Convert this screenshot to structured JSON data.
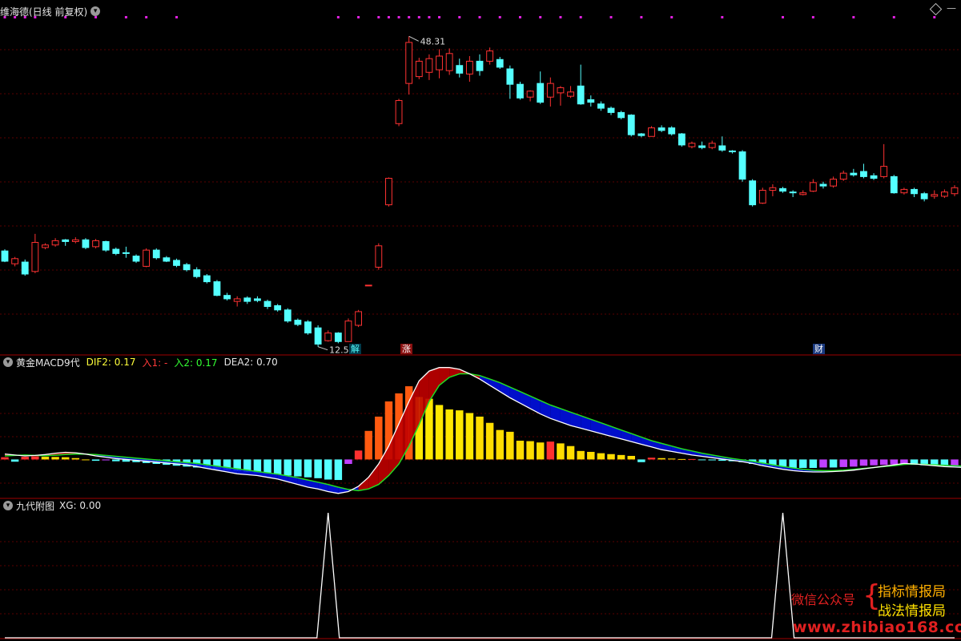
{
  "window": {
    "title": "维海德(日线 前复权)",
    "colors": {
      "bg": "#000000",
      "up": "#ff3232",
      "down": "#54ffff",
      "grid": "#5a0000",
      "panel_border": "#a00000"
    }
  },
  "main_panel": {
    "high_label": "48.31",
    "low_label": "12.59",
    "tags": [
      {
        "text": "解",
        "color": "#54ffff",
        "bg": "#003a4a"
      },
      {
        "text": "涨",
        "color": "#ffffff",
        "bg": "#8a1010"
      },
      {
        "text": "财",
        "color": "#ffffff",
        "bg": "#1a3a80"
      }
    ]
  },
  "macd_panel": {
    "title": "黄金MACD9代",
    "dif_label": "DIF2: 0.17",
    "in1_label": "入1: -",
    "in2_label": "入2: 0.17",
    "dea_label": "DEA2: 0.70"
  },
  "sub_panel": {
    "title": "九代附图",
    "xg_label": "XG: 0.00"
  },
  "watermark": {
    "line1": "微信公众号",
    "brand1": "指标情报局",
    "brand2": "战法情报局",
    "url": "www.zhibiao168.com"
  },
  "chart_data": [
    {
      "type": "candlestick",
      "title": "维海德(日线 前复权)",
      "ylim": [
        11.5,
        50.5
      ],
      "candles": [
        {
          "o": 23.2,
          "c": 22.0,
          "h": 23.4,
          "l": 21.9
        },
        {
          "o": 21.7,
          "c": 22.3,
          "h": 22.5,
          "l": 21.4
        },
        {
          "o": 21.9,
          "c": 20.5,
          "h": 22.2,
          "l": 20.3
        },
        {
          "o": 20.8,
          "c": 24.2,
          "h": 25.2,
          "l": 20.6
        },
        {
          "o": 23.6,
          "c": 23.9,
          "h": 24.1,
          "l": 23.4
        },
        {
          "o": 23.9,
          "c": 24.4,
          "h": 24.7,
          "l": 23.7
        },
        {
          "o": 24.5,
          "c": 24.3,
          "h": 24.6,
          "l": 23.8
        },
        {
          "o": 24.3,
          "c": 24.5,
          "h": 24.8,
          "l": 24.1
        },
        {
          "o": 24.5,
          "c": 23.6,
          "h": 24.7,
          "l": 23.4
        },
        {
          "o": 23.7,
          "c": 24.4,
          "h": 24.6,
          "l": 23.5
        },
        {
          "o": 24.3,
          "c": 23.3,
          "h": 24.4,
          "l": 23.1
        },
        {
          "o": 23.4,
          "c": 22.9,
          "h": 23.6,
          "l": 22.7
        },
        {
          "o": 23.0,
          "c": 22.9,
          "h": 23.7,
          "l": 22.4
        },
        {
          "o": 22.6,
          "c": 22.0,
          "h": 22.8,
          "l": 21.8
        },
        {
          "o": 21.4,
          "c": 23.3,
          "h": 23.5,
          "l": 21.3
        },
        {
          "o": 23.3,
          "c": 22.4,
          "h": 23.5,
          "l": 22.2
        },
        {
          "o": 22.4,
          "c": 22.0,
          "h": 22.6,
          "l": 21.9
        },
        {
          "o": 22.1,
          "c": 21.5,
          "h": 22.3,
          "l": 21.3
        },
        {
          "o": 21.6,
          "c": 21.0,
          "h": 21.8,
          "l": 20.8
        },
        {
          "o": 21.0,
          "c": 20.2,
          "h": 21.3,
          "l": 20.0
        },
        {
          "o": 20.3,
          "c": 19.6,
          "h": 20.5,
          "l": 19.4
        },
        {
          "o": 19.6,
          "c": 18.0,
          "h": 19.8,
          "l": 17.9
        },
        {
          "o": 18.0,
          "c": 17.6,
          "h": 18.3,
          "l": 17.4
        },
        {
          "o": 17.3,
          "c": 17.6,
          "h": 17.9,
          "l": 16.7
        },
        {
          "o": 17.7,
          "c": 17.3,
          "h": 17.9,
          "l": 17.0
        },
        {
          "o": 17.6,
          "c": 17.4,
          "h": 17.9,
          "l": 17.2
        },
        {
          "o": 17.3,
          "c": 16.7,
          "h": 17.5,
          "l": 16.4
        },
        {
          "o": 16.8,
          "c": 16.3,
          "h": 17.0,
          "l": 16.1
        },
        {
          "o": 16.3,
          "c": 15.0,
          "h": 16.5,
          "l": 14.8
        },
        {
          "o": 15.1,
          "c": 14.6,
          "h": 15.3,
          "l": 14.4
        },
        {
          "o": 14.9,
          "c": 13.6,
          "h": 15.1,
          "l": 13.4
        },
        {
          "o": 14.2,
          "c": 12.3,
          "h": 14.5,
          "l": 12.0
        },
        {
          "o": 12.7,
          "c": 13.6,
          "h": 13.9,
          "l": 12.59
        },
        {
          "o": 13.6,
          "c": 12.6,
          "h": 13.7,
          "l": 12.4
        },
        {
          "o": 12.6,
          "c": 15.0,
          "h": 15.3,
          "l": 12.6
        },
        {
          "o": 14.5,
          "c": 16.1,
          "h": 16.3,
          "l": 14.3
        },
        {
          "o": 19.2,
          "c": 19.2,
          "h": 19.2,
          "l": 19.2
        },
        {
          "o": 21.3,
          "c": 23.8,
          "h": 24.1,
          "l": 21.0
        },
        {
          "o": 28.6,
          "c": 31.7,
          "h": 31.8,
          "l": 28.4
        },
        {
          "o": 38.1,
          "c": 40.8,
          "h": 41.0,
          "l": 37.8
        },
        {
          "o": 42.8,
          "c": 47.6,
          "h": 48.31,
          "l": 41.5
        },
        {
          "o": 43.6,
          "c": 45.4,
          "h": 45.8,
          "l": 43.3
        },
        {
          "o": 44.1,
          "c": 45.7,
          "h": 46.2,
          "l": 43.2
        },
        {
          "o": 44.4,
          "c": 46.0,
          "h": 46.8,
          "l": 43.4
        },
        {
          "o": 44.3,
          "c": 46.3,
          "h": 46.9,
          "l": 43.8
        },
        {
          "o": 44.9,
          "c": 44.0,
          "h": 45.7,
          "l": 43.5
        },
        {
          "o": 43.9,
          "c": 45.4,
          "h": 46.0,
          "l": 43.0
        },
        {
          "o": 45.4,
          "c": 44.3,
          "h": 46.2,
          "l": 43.7
        },
        {
          "o": 45.4,
          "c": 46.6,
          "h": 47.0,
          "l": 45.0
        },
        {
          "o": 45.6,
          "c": 44.7,
          "h": 45.9,
          "l": 44.5
        },
        {
          "o": 44.5,
          "c": 42.7,
          "h": 44.9,
          "l": 41.0
        },
        {
          "o": 42.7,
          "c": 41.1,
          "h": 43.0,
          "l": 40.9
        },
        {
          "o": 41.2,
          "c": 41.9,
          "h": 42.0,
          "l": 40.7
        },
        {
          "o": 42.8,
          "c": 40.6,
          "h": 44.2,
          "l": 40.4
        },
        {
          "o": 41.2,
          "c": 42.8,
          "h": 43.5,
          "l": 40.1
        },
        {
          "o": 41.7,
          "c": 42.3,
          "h": 42.5,
          "l": 40.2
        },
        {
          "o": 41.3,
          "c": 41.8,
          "h": 42.5,
          "l": 41.1
        },
        {
          "o": 42.5,
          "c": 40.4,
          "h": 45.0,
          "l": 40.3
        },
        {
          "o": 40.9,
          "c": 40.6,
          "h": 41.4,
          "l": 40.1
        },
        {
          "o": 40.4,
          "c": 39.9,
          "h": 40.7,
          "l": 39.6
        },
        {
          "o": 39.9,
          "c": 39.4,
          "h": 40.1,
          "l": 39.1
        },
        {
          "o": 39.4,
          "c": 38.8,
          "h": 39.6,
          "l": 38.6
        },
        {
          "o": 39.1,
          "c": 36.8,
          "h": 39.2,
          "l": 36.6
        },
        {
          "o": 36.9,
          "c": 36.7,
          "h": 37.0,
          "l": 36.5
        },
        {
          "o": 36.6,
          "c": 37.6,
          "h": 37.8,
          "l": 36.6
        },
        {
          "o": 37.6,
          "c": 37.3,
          "h": 37.9,
          "l": 37.1
        },
        {
          "o": 37.6,
          "c": 36.9,
          "h": 37.8,
          "l": 36.7
        },
        {
          "o": 36.9,
          "c": 35.6,
          "h": 37.0,
          "l": 35.4
        },
        {
          "o": 35.4,
          "c": 35.8,
          "h": 36.0,
          "l": 35.2
        },
        {
          "o": 35.5,
          "c": 35.3,
          "h": 36.0,
          "l": 35.1
        },
        {
          "o": 35.3,
          "c": 35.8,
          "h": 36.1,
          "l": 35.1
        },
        {
          "o": 35.5,
          "c": 35.0,
          "h": 36.6,
          "l": 34.8
        },
        {
          "o": 34.9,
          "c": 34.8,
          "h": 35.0,
          "l": 34.6
        },
        {
          "o": 34.8,
          "c": 31.6,
          "h": 35.0,
          "l": 31.3
        },
        {
          "o": 31.4,
          "c": 28.6,
          "h": 31.6,
          "l": 28.4
        },
        {
          "o": 28.8,
          "c": 30.3,
          "h": 30.6,
          "l": 28.7
        },
        {
          "o": 30.3,
          "c": 30.6,
          "h": 31.0,
          "l": 29.6
        },
        {
          "o": 30.5,
          "c": 30.2,
          "h": 30.7,
          "l": 30.0
        },
        {
          "o": 30.1,
          "c": 30.0,
          "h": 30.3,
          "l": 29.5
        },
        {
          "o": 29.8,
          "c": 30.0,
          "h": 30.3,
          "l": 29.7
        },
        {
          "o": 30.2,
          "c": 31.2,
          "h": 31.6,
          "l": 30.1
        },
        {
          "o": 31.0,
          "c": 30.8,
          "h": 31.3,
          "l": 30.5
        },
        {
          "o": 30.8,
          "c": 31.6,
          "h": 31.9,
          "l": 30.6
        },
        {
          "o": 31.6,
          "c": 32.3,
          "h": 32.6,
          "l": 31.4
        },
        {
          "o": 32.3,
          "c": 32.1,
          "h": 32.8,
          "l": 31.9
        },
        {
          "o": 32.5,
          "c": 31.9,
          "h": 33.4,
          "l": 31.7
        },
        {
          "o": 32.0,
          "c": 31.7,
          "h": 32.3,
          "l": 31.5
        },
        {
          "o": 31.9,
          "c": 33.1,
          "h": 35.7,
          "l": 31.7
        },
        {
          "o": 31.9,
          "c": 30.0,
          "h": 32.1,
          "l": 29.9
        },
        {
          "o": 30.0,
          "c": 30.4,
          "h": 30.6,
          "l": 29.8
        },
        {
          "o": 30.4,
          "c": 29.9,
          "h": 30.6,
          "l": 29.5
        },
        {
          "o": 29.9,
          "c": 29.3,
          "h": 30.1,
          "l": 29.0
        },
        {
          "o": 29.6,
          "c": 29.8,
          "h": 30.3,
          "l": 29.3
        },
        {
          "o": 29.6,
          "c": 30.1,
          "h": 30.4,
          "l": 29.4
        },
        {
          "o": 29.9,
          "c": 30.6,
          "h": 30.9,
          "l": 29.6
        }
      ]
    },
    {
      "type": "bar",
      "title": "黄金MACD9代",
      "ylim": [
        -4,
        10
      ],
      "values": [
        0.25,
        -0.25,
        0.3,
        0.35,
        0.3,
        0.28,
        0.25,
        0.15,
        0,
        -0.15,
        -0.1,
        -0.2,
        -0.25,
        -0.3,
        -0.4,
        -0.5,
        -0.6,
        -0.7,
        -0.8,
        -0.9,
        -1.0,
        -1.1,
        -1.2,
        -1.3,
        -1.4,
        -1.5,
        -1.6,
        -1.7,
        -1.8,
        -1.9,
        -2.0,
        -2.1,
        -2.25,
        -2.3,
        -0.5,
        1.0,
        3.2,
        4.8,
        6.5,
        7.4,
        8.2,
        7.0,
        6.8,
        6.1,
        5.6,
        5.5,
        5.2,
        4.8,
        4.1,
        3.3,
        3.1,
        2.1,
        2.05,
        1.9,
        2.0,
        1.8,
        1.5,
        0.95,
        0.85,
        0.7,
        0.6,
        0.5,
        0.4,
        -0.3,
        0.2,
        0.15,
        0.1,
        0.05,
        0.05,
        -0.05,
        -0.1,
        -0.15,
        -0.2,
        -0.3,
        -0.5,
        -0.7,
        -0.8,
        -0.9,
        -0.95,
        -0.95,
        -0.95,
        -0.9,
        -0.9,
        -0.85,
        -0.8,
        -0.7,
        -0.65,
        -0.6,
        -0.55,
        -0.5,
        -0.6,
        -0.65,
        -0.7,
        -0.75,
        -0.7,
        -0.65
      ],
      "series": [
        {
          "values": [
            0.6,
            0.5,
            0.4,
            0.45,
            0.55,
            0.7,
            0.8,
            0.75,
            0.6,
            0.4,
            0.25,
            0.1,
            0,
            -0.1,
            -0.2,
            -0.3,
            -0.4,
            -0.5,
            -0.6,
            -0.8,
            -1.0,
            -1.2,
            -1.4,
            -1.6,
            -1.7,
            -1.8,
            -2.0,
            -2.2,
            -2.5,
            -2.8,
            -3.1,
            -3.3,
            -3.6,
            -3.8,
            -3.6,
            -3.0,
            -2.0,
            -0.5,
            1.5,
            4.0,
            6.5,
            8.8,
            9.9,
            10.3,
            10.3,
            10.1,
            9.6,
            9.0,
            8.3,
            7.6,
            6.9,
            6.3,
            5.7,
            5.1,
            4.6,
            4.2,
            3.8,
            3.5,
            3.2,
            2.9,
            2.6,
            2.3,
            2.0,
            1.7,
            1.4,
            1.1,
            0.9,
            0.7,
            0.5,
            0.35,
            0.2,
            0.05,
            -0.1,
            -0.25,
            -0.45,
            -0.7,
            -0.9,
            -1.1,
            -1.25,
            -1.35,
            -1.4,
            -1.4,
            -1.35,
            -1.3,
            -1.2,
            -1.05,
            -0.9,
            -0.75,
            -0.6,
            -0.45,
            -0.5,
            -0.6,
            -0.7,
            -0.8,
            -0.85,
            -0.9
          ]
        },
        {
          "values": [
            0.4,
            0.45,
            0.5,
            0.45,
            0.42,
            0.48,
            0.55,
            0.6,
            0.6,
            0.55,
            0.45,
            0.35,
            0.25,
            0.15,
            0.05,
            -0.05,
            -0.15,
            -0.25,
            -0.35,
            -0.45,
            -0.6,
            -0.75,
            -0.9,
            -1.05,
            -1.2,
            -1.35,
            -1.5,
            -1.65,
            -1.85,
            -2.05,
            -2.3,
            -2.55,
            -2.8,
            -3.1,
            -3.35,
            -3.5,
            -3.3,
            -2.8,
            -1.8,
            -0.5,
            1.5,
            3.9,
            6.5,
            8.3,
            9.2,
            9.6,
            9.6,
            9.4,
            9.0,
            8.6,
            8.1,
            7.6,
            7.1,
            6.6,
            6.1,
            5.7,
            5.3,
            4.9,
            4.5,
            4.1,
            3.7,
            3.3,
            2.9,
            2.5,
            2.1,
            1.8,
            1.5,
            1.2,
            0.95,
            0.7,
            0.5,
            0.3,
            0.1,
            -0.05,
            -0.2,
            -0.4,
            -0.6,
            -0.8,
            -0.95,
            -1.1,
            -1.2,
            -1.25,
            -1.25,
            -1.2,
            -1.1,
            -1.0,
            -0.9,
            -0.8,
            -0.7,
            -0.55,
            -0.5,
            -0.55,
            -0.6,
            -0.65,
            -0.7,
            -0.75
          ]
        }
      ]
    },
    {
      "type": "line",
      "title": "九代附图",
      "ylim": [
        0,
        1
      ],
      "signals": [
        {
          "index": 32,
          "value": 1
        },
        {
          "index": 77,
          "value": 1
        }
      ]
    }
  ]
}
